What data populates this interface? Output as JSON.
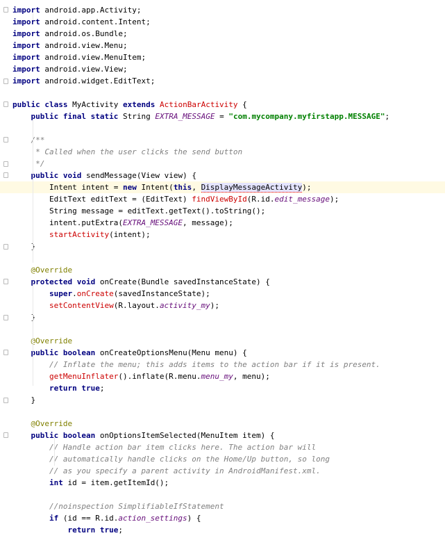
{
  "editor": {
    "language": "Java",
    "caret_line": 15,
    "colors": {
      "keyword": "#000080",
      "string": "#008000",
      "comment": "#808080",
      "annotation": "#808000",
      "unresolved": "#cc0000",
      "field": "#660e7a",
      "caret_line": "#fffae3"
    },
    "lines": [
      "import android.app.Activity;",
      "import android.content.Intent;",
      "import android.os.Bundle;",
      "import android.view.Menu;",
      "import android.view.MenuItem;",
      "import android.view.View;",
      "import android.widget.EditText;",
      "",
      "public class MyActivity extends ActionBarActivity {",
      "    public final static String EXTRA_MESSAGE = \"com.mycompany.myfirstapp.MESSAGE\";",
      "",
      "    /**",
      "     * Called when the user clicks the send button",
      "     */",
      "    public void sendMessage(View view) {",
      "        Intent intent = new Intent(this, DisplayMessageActivity);",
      "        EditText editText = (EditText) findViewById(R.id.edit_message);",
      "        String message = editText.getText().toString();",
      "        intent.putExtra(EXTRA_MESSAGE, message);",
      "        startActivity(intent);",
      "    }",
      "",
      "    @Override",
      "    protected void onCreate(Bundle savedInstanceState) {",
      "        super.onCreate(savedInstanceState);",
      "        setContentView(R.layout.activity_my);",
      "    }",
      "",
      "    @Override",
      "    public boolean onCreateOptionsMenu(Menu menu) {",
      "        // Inflate the menu; this adds items to the action bar if it is present.",
      "        getMenuInflater().inflate(R.menu.menu_my, menu);",
      "        return true;",
      "    }",
      "",
      "    @Override",
      "    public boolean onOptionsItemSelected(MenuItem item) {",
      "        // Handle action bar item clicks here. The action bar will",
      "        // automatically handle clicks on the Home/Up button, so long",
      "        // as you specify a parent activity in AndroidManifest.xml.",
      "        int id = item.getItemId();",
      "",
      "        //noinspection SimplifiableIfStatement",
      "        if (id == R.id.action_settings) {",
      "            return true;"
    ]
  }
}
